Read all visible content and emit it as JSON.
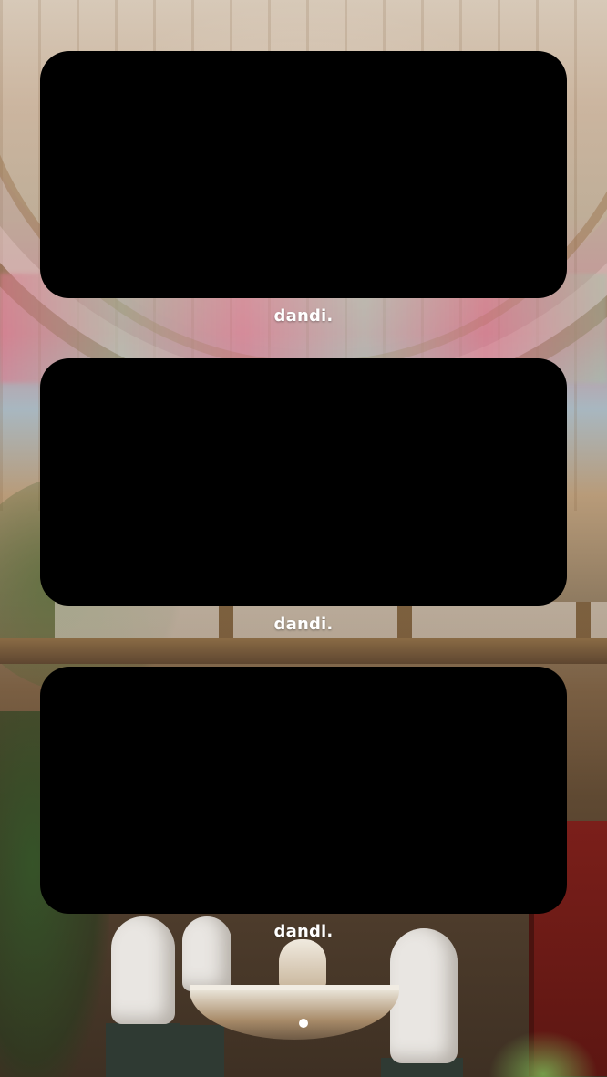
{
  "home_screen": {
    "widgets": [
      {
        "label": "dandi."
      },
      {
        "label": "dandi."
      },
      {
        "label": "dandi."
      }
    ],
    "page_indicator": {
      "current_page": 1,
      "total_pages": 1
    }
  },
  "theme": {
    "widget_background": "#000000",
    "label_color": "#ffffff",
    "page_dot_active": "#ffffff"
  }
}
